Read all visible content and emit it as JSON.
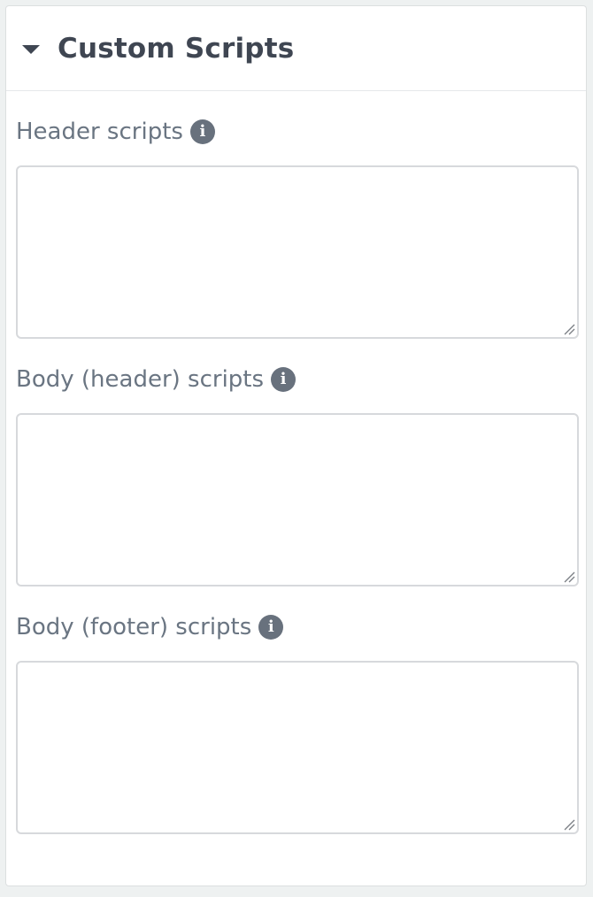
{
  "panel": {
    "title": "Custom Scripts",
    "collapse_icon": "caret-down-icon"
  },
  "fields": [
    {
      "label": "Header scripts",
      "value": "",
      "placeholder": "",
      "info_icon": "info-icon"
    },
    {
      "label": "Body (header) scripts",
      "value": "",
      "placeholder": "",
      "info_icon": "info-icon"
    },
    {
      "label": "Body (footer) scripts",
      "value": "",
      "placeholder": "",
      "info_icon": "info-icon"
    }
  ],
  "colors": {
    "title": "#3f4652",
    "label": "#6a7582",
    "info_icon_bg": "#68717d",
    "border": "#d7d9dc",
    "page_bg": "#eef1f1"
  }
}
